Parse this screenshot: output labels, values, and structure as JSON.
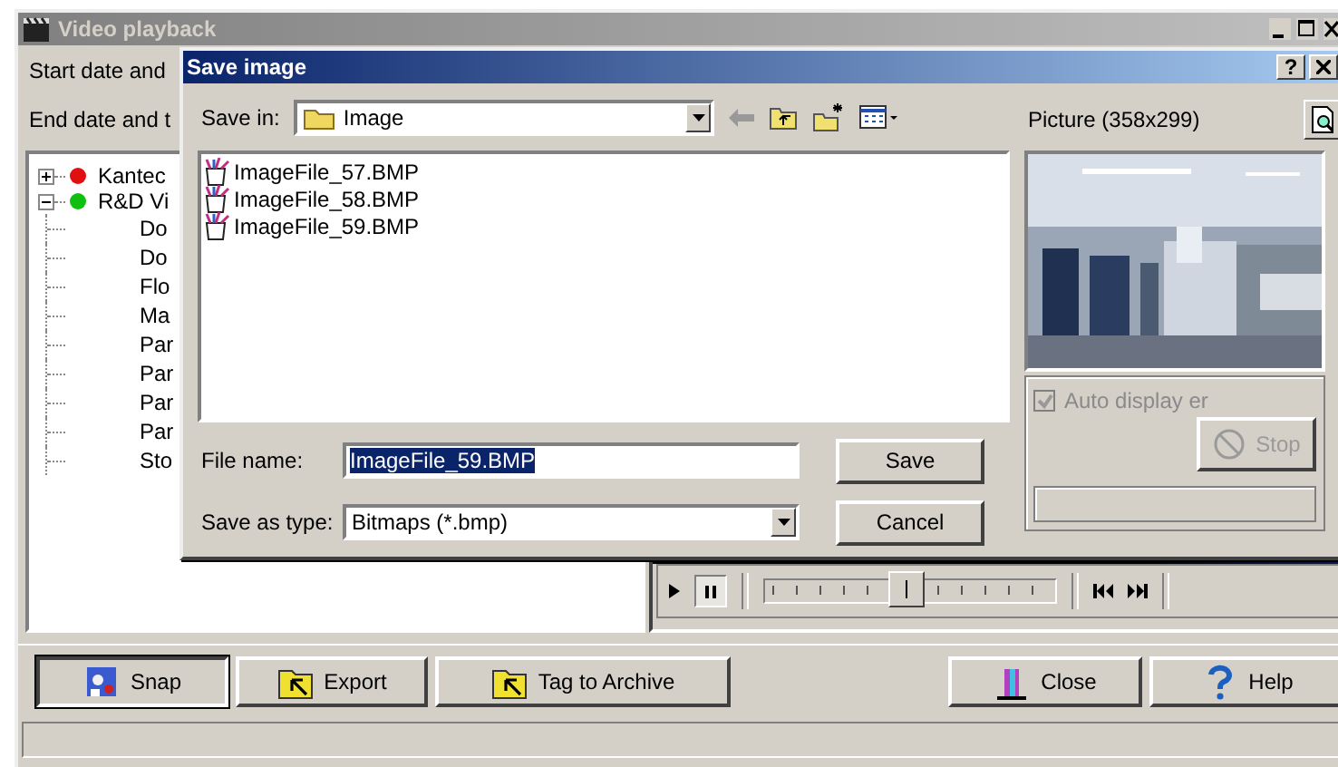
{
  "main_window": {
    "title": "Video playback",
    "start_label": "Start date and",
    "end_label": "End date and t",
    "tree": [
      {
        "label": "Kantec",
        "color": "#e01010",
        "expanded": false
      },
      {
        "label": "R&D Vi",
        "color": "#10c010",
        "expanded": true,
        "children": [
          {
            "label": "Do"
          },
          {
            "label": "Do"
          },
          {
            "label": "Flo"
          },
          {
            "label": "Ma"
          },
          {
            "label": "Par"
          },
          {
            "label": "Par"
          },
          {
            "label": "Par"
          },
          {
            "label": "Par"
          },
          {
            "label": "Sto"
          }
        ]
      }
    ],
    "player": {
      "pause_selected": true,
      "slider": {
        "level": 0.45
      }
    },
    "buttons": [
      {
        "label": "Snap",
        "kind": "snap",
        "selected": true
      },
      {
        "label": "Export",
        "kind": "export",
        "selected": false
      },
      {
        "label": "Tag to Archive",
        "kind": "archive",
        "selected": false
      },
      {
        "label": "Close",
        "kind": "close",
        "selected": false
      },
      {
        "label": "Help",
        "kind": "help",
        "selected": false
      }
    ]
  },
  "dialog": {
    "title": "Save image",
    "help": "?",
    "save_in": {
      "label": "Save in:",
      "value": "Image"
    },
    "files": [
      "ImageFile_57.BMP",
      "ImageFile_58.BMP",
      "ImageFile_59.BMP"
    ],
    "file_name": {
      "label": "File name:",
      "value": "ImageFile_59.BMP",
      "selected": true
    },
    "save_as_type": {
      "label": "Save as type:",
      "value": "Bitmaps (*.bmp)"
    },
    "save_button": "Save",
    "cancel_button": "Cancel",
    "picture": {
      "title": "Picture (358x299)"
    },
    "auto_display": {
      "label": "Auto display er",
      "checked": true,
      "disabled": true
    },
    "stop": {
      "label": "Stop",
      "disabled": true
    }
  }
}
